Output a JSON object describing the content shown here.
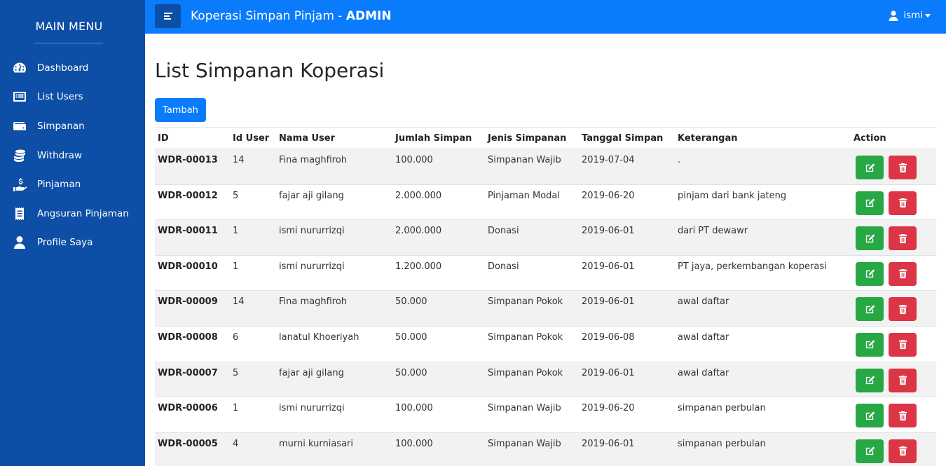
{
  "sidebar": {
    "title": "MAIN MENU",
    "items": [
      {
        "label": "Dashboard",
        "icon": "tachometer-icon"
      },
      {
        "label": "List Users",
        "icon": "list-icon"
      },
      {
        "label": "Simpanan",
        "icon": "wallet-icon"
      },
      {
        "label": "Withdraw",
        "icon": "coins-icon"
      },
      {
        "label": "Pinjaman",
        "icon": "hand-holding-usd-icon"
      },
      {
        "label": "Angsuran Pinjaman",
        "icon": "receipt-icon"
      },
      {
        "label": "Profile Saya",
        "icon": "user-icon"
      }
    ]
  },
  "topbar": {
    "title_prefix": "Koperasi Simpan Pinjam - ",
    "title_bold": "ADMIN",
    "user_name": "ismi"
  },
  "page": {
    "title": "List Simpanan Koperasi",
    "add_button": "Tambah"
  },
  "table": {
    "headers": [
      "ID",
      "Id User",
      "Nama User",
      "Jumlah Simpan",
      "Jenis Simpanan",
      "Tanggal Simpan",
      "Keterangan",
      "Action"
    ],
    "rows": [
      [
        "WDR-00013",
        "14",
        "Fina maghfiroh",
        "100.000",
        "Simpanan Wajib",
        "2019-07-04",
        "."
      ],
      [
        "WDR-00012",
        "5",
        "fajar aji gilang",
        "2.000.000",
        "Pinjaman Modal",
        "2019-06-20",
        "pinjam dari bank jateng"
      ],
      [
        "WDR-00011",
        "1",
        "ismi nururrizqi",
        "2.000.000",
        "Donasi",
        "2019-06-01",
        "dari PT dewawr"
      ],
      [
        "WDR-00010",
        "1",
        "ismi nururrizqi",
        "1.200.000",
        "Donasi",
        "2019-06-01",
        "PT jaya, perkembangan koperasi"
      ],
      [
        "WDR-00009",
        "14",
        "Fina maghfiroh",
        "50.000",
        "Simpanan Pokok",
        "2019-06-01",
        "awal daftar"
      ],
      [
        "WDR-00008",
        "6",
        "lanatul Khoeriyah",
        "50.000",
        "Simpanan Pokok",
        "2019-06-08",
        "awal daftar"
      ],
      [
        "WDR-00007",
        "5",
        "fajar aji gilang",
        "50.000",
        "Simpanan Pokok",
        "2019-06-01",
        "awal daftar"
      ],
      [
        "WDR-00006",
        "1",
        "ismi nururrizqi",
        "100.000",
        "Simpanan Wajib",
        "2019-06-20",
        "simpanan perbulan"
      ],
      [
        "WDR-00005",
        "4",
        "murni kurniasari",
        "100.000",
        "Simpanan Wajib",
        "2019-06-01",
        "simpanan perbulan"
      ]
    ]
  },
  "colors": {
    "sidebar_bg": "#0d4fa6",
    "topbar_bg": "#0a7bfb",
    "edit_button": "#28a745",
    "delete_button": "#dc3545"
  }
}
